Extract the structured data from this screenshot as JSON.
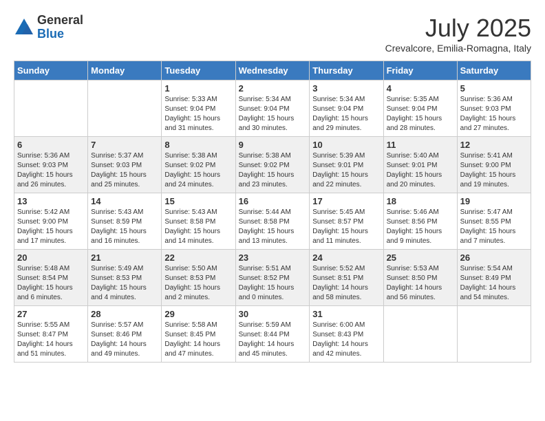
{
  "header": {
    "logo_general": "General",
    "logo_blue": "Blue",
    "month_title": "July 2025",
    "location": "Crevalcore, Emilia-Romagna, Italy"
  },
  "days_of_week": [
    "Sunday",
    "Monday",
    "Tuesday",
    "Wednesday",
    "Thursday",
    "Friday",
    "Saturday"
  ],
  "weeks": [
    [
      {
        "day": "",
        "info": ""
      },
      {
        "day": "",
        "info": ""
      },
      {
        "day": "1",
        "info": "Sunrise: 5:33 AM\nSunset: 9:04 PM\nDaylight: 15 hours\nand 31 minutes."
      },
      {
        "day": "2",
        "info": "Sunrise: 5:34 AM\nSunset: 9:04 PM\nDaylight: 15 hours\nand 30 minutes."
      },
      {
        "day": "3",
        "info": "Sunrise: 5:34 AM\nSunset: 9:04 PM\nDaylight: 15 hours\nand 29 minutes."
      },
      {
        "day": "4",
        "info": "Sunrise: 5:35 AM\nSunset: 9:04 PM\nDaylight: 15 hours\nand 28 minutes."
      },
      {
        "day": "5",
        "info": "Sunrise: 5:36 AM\nSunset: 9:03 PM\nDaylight: 15 hours\nand 27 minutes."
      }
    ],
    [
      {
        "day": "6",
        "info": "Sunrise: 5:36 AM\nSunset: 9:03 PM\nDaylight: 15 hours\nand 26 minutes."
      },
      {
        "day": "7",
        "info": "Sunrise: 5:37 AM\nSunset: 9:03 PM\nDaylight: 15 hours\nand 25 minutes."
      },
      {
        "day": "8",
        "info": "Sunrise: 5:38 AM\nSunset: 9:02 PM\nDaylight: 15 hours\nand 24 minutes."
      },
      {
        "day": "9",
        "info": "Sunrise: 5:38 AM\nSunset: 9:02 PM\nDaylight: 15 hours\nand 23 minutes."
      },
      {
        "day": "10",
        "info": "Sunrise: 5:39 AM\nSunset: 9:01 PM\nDaylight: 15 hours\nand 22 minutes."
      },
      {
        "day": "11",
        "info": "Sunrise: 5:40 AM\nSunset: 9:01 PM\nDaylight: 15 hours\nand 20 minutes."
      },
      {
        "day": "12",
        "info": "Sunrise: 5:41 AM\nSunset: 9:00 PM\nDaylight: 15 hours\nand 19 minutes."
      }
    ],
    [
      {
        "day": "13",
        "info": "Sunrise: 5:42 AM\nSunset: 9:00 PM\nDaylight: 15 hours\nand 17 minutes."
      },
      {
        "day": "14",
        "info": "Sunrise: 5:43 AM\nSunset: 8:59 PM\nDaylight: 15 hours\nand 16 minutes."
      },
      {
        "day": "15",
        "info": "Sunrise: 5:43 AM\nSunset: 8:58 PM\nDaylight: 15 hours\nand 14 minutes."
      },
      {
        "day": "16",
        "info": "Sunrise: 5:44 AM\nSunset: 8:58 PM\nDaylight: 15 hours\nand 13 minutes."
      },
      {
        "day": "17",
        "info": "Sunrise: 5:45 AM\nSunset: 8:57 PM\nDaylight: 15 hours\nand 11 minutes."
      },
      {
        "day": "18",
        "info": "Sunrise: 5:46 AM\nSunset: 8:56 PM\nDaylight: 15 hours\nand 9 minutes."
      },
      {
        "day": "19",
        "info": "Sunrise: 5:47 AM\nSunset: 8:55 PM\nDaylight: 15 hours\nand 7 minutes."
      }
    ],
    [
      {
        "day": "20",
        "info": "Sunrise: 5:48 AM\nSunset: 8:54 PM\nDaylight: 15 hours\nand 6 minutes."
      },
      {
        "day": "21",
        "info": "Sunrise: 5:49 AM\nSunset: 8:53 PM\nDaylight: 15 hours\nand 4 minutes."
      },
      {
        "day": "22",
        "info": "Sunrise: 5:50 AM\nSunset: 8:53 PM\nDaylight: 15 hours\nand 2 minutes."
      },
      {
        "day": "23",
        "info": "Sunrise: 5:51 AM\nSunset: 8:52 PM\nDaylight: 15 hours\nand 0 minutes."
      },
      {
        "day": "24",
        "info": "Sunrise: 5:52 AM\nSunset: 8:51 PM\nDaylight: 14 hours\nand 58 minutes."
      },
      {
        "day": "25",
        "info": "Sunrise: 5:53 AM\nSunset: 8:50 PM\nDaylight: 14 hours\nand 56 minutes."
      },
      {
        "day": "26",
        "info": "Sunrise: 5:54 AM\nSunset: 8:49 PM\nDaylight: 14 hours\nand 54 minutes."
      }
    ],
    [
      {
        "day": "27",
        "info": "Sunrise: 5:55 AM\nSunset: 8:47 PM\nDaylight: 14 hours\nand 51 minutes."
      },
      {
        "day": "28",
        "info": "Sunrise: 5:57 AM\nSunset: 8:46 PM\nDaylight: 14 hours\nand 49 minutes."
      },
      {
        "day": "29",
        "info": "Sunrise: 5:58 AM\nSunset: 8:45 PM\nDaylight: 14 hours\nand 47 minutes."
      },
      {
        "day": "30",
        "info": "Sunrise: 5:59 AM\nSunset: 8:44 PM\nDaylight: 14 hours\nand 45 minutes."
      },
      {
        "day": "31",
        "info": "Sunrise: 6:00 AM\nSunset: 8:43 PM\nDaylight: 14 hours\nand 42 minutes."
      },
      {
        "day": "",
        "info": ""
      },
      {
        "day": "",
        "info": ""
      }
    ]
  ]
}
